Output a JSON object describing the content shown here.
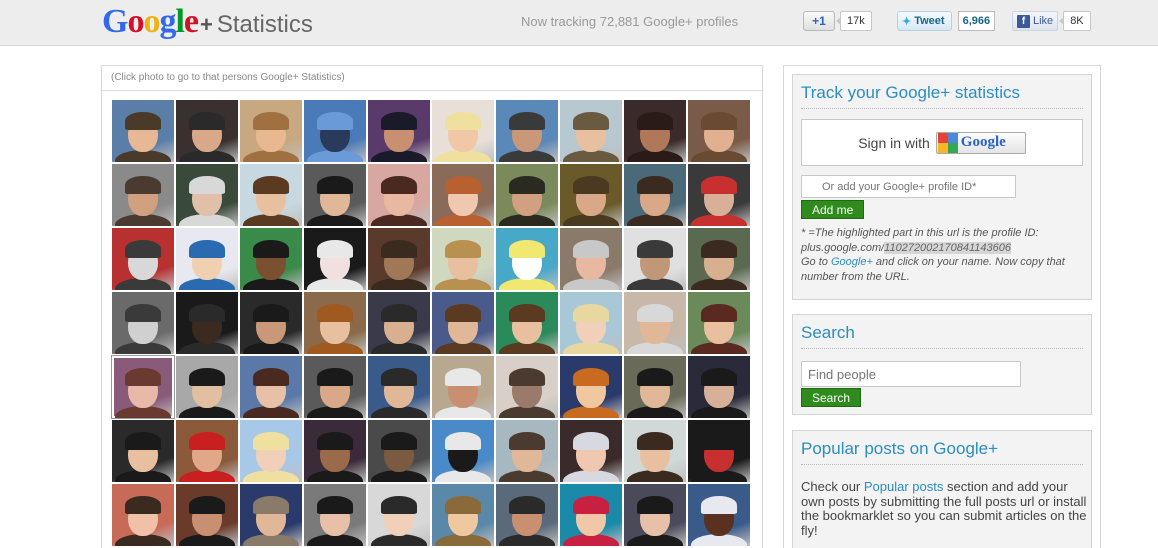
{
  "header": {
    "logo_parts": [
      "G",
      "o",
      "o",
      "g",
      "l",
      "e"
    ],
    "logo_plus": "+",
    "logo_suffix": "Statistics",
    "tracking_text": "Now tracking 72,881 Google+ profiles",
    "plus_one": {
      "label": "+1",
      "count": "17k"
    },
    "tweet": {
      "label": "Tweet",
      "count": "6,966"
    },
    "like": {
      "label": "Like",
      "count": "8K"
    }
  },
  "photos": {
    "caption": "(Click photo to go to that persons Google+ Statistics)",
    "tiles": [
      [
        "#5b7ea8",
        "#e8b896",
        "#4a3a2a"
      ],
      [
        "#3a3030",
        "#d8a888",
        "#2a2a2a"
      ],
      [
        "#c8a880",
        "#e8b890",
        "#a07040"
      ],
      [
        "#4a7ab8",
        "#2a3a5a",
        "#6a9ad8"
      ],
      [
        "#5a3a6a",
        "#c89070",
        "#1a1a2a"
      ],
      [
        "#e8e0d8",
        "#f0c8a8",
        "#f0e0a0"
      ],
      [
        "#5a88b8",
        "#c89878",
        "#3a3a3a"
      ],
      [
        "#b8c8d0",
        "#e8c0a0",
        "#6a5a40"
      ],
      [
        "#3a2a2a",
        "#b07858",
        "#2a1a18"
      ],
      [
        "#7a5a48",
        "#e0b090",
        "#6a4a30"
      ],
      [
        "#8a8a8a",
        "#d0a080",
        "#4a3a30"
      ],
      [
        "#3a4a3a",
        "#e0c0a8",
        "#d8d8d8"
      ],
      [
        "#c8d8e0",
        "#e8c0a0",
        "#5a3a20"
      ],
      [
        "#5a5a5a",
        "#e0b898",
        "#1a1a1a"
      ],
      [
        "#d8a8a0",
        "#e8b8a0",
        "#4a2a20"
      ],
      [
        "#8a6a58",
        "#f0c8b0",
        "#b86030"
      ],
      [
        "#7a8a5a",
        "#d0a080",
        "#2a2a20"
      ],
      [
        "#6a5a2a",
        "#d8a888",
        "#4a3a20"
      ],
      [
        "#4a6a7a",
        "#d8a888",
        "#3a2a20"
      ],
      [
        "#3a3a3a",
        "#d8b098",
        "#c83030"
      ],
      [
        "#b83030",
        "#d8d8d8",
        "#3a3a3a"
      ],
      [
        "#e8e8f0",
        "#f0d0b0",
        "#2a6ab0"
      ],
      [
        "#3a8a4a",
        "#7a5030",
        "#1a1a1a"
      ],
      [
        "#1a1a1a",
        "#f0e0e0",
        "#e8e8e8"
      ],
      [
        "#5a3a2a",
        "#a07858",
        "#3a2a20"
      ],
      [
        "#d0d8c0",
        "#e8c0a0",
        "#b89050"
      ],
      [
        "#48a8c8",
        "#ffffff",
        "#f0e870"
      ],
      [
        "#8a7a6a",
        "#e8b8a0",
        "#c8c8c8"
      ],
      [
        "#e0e0e0",
        "#c09878",
        "#3a3a3a"
      ],
      [
        "#5a6a50",
        "#d8b090",
        "#3a2a20"
      ],
      [
        "#6a6a6a",
        "#d0d0d0",
        "#3a3a3a"
      ],
      [
        "#1a1a1a",
        "#3a2a20",
        "#2a2a2a"
      ],
      [
        "#2a2a2a",
        "#c89878",
        "#1a1a1a"
      ],
      [
        "#8a6a4a",
        "#e8c0a0",
        "#a05a20"
      ],
      [
        "#3a3a4a",
        "#d8b090",
        "#2a2a2a"
      ],
      [
        "#4a5a8a",
        "#e0b898",
        "#5a3a20"
      ],
      [
        "#2a8a5a",
        "#e8c0a0",
        "#5a3a20"
      ],
      [
        "#a8c8d8",
        "#f0d0b8",
        "#e8d8a0"
      ],
      [
        "#c8b8a8",
        "#e0b898",
        "#d8d8d8"
      ],
      [
        "#6a8a5a",
        "#e8c0a0",
        "#5a2a20"
      ],
      [
        "#8a5a7a",
        "#e8b8a8",
        "#6a3a30"
      ],
      [
        "#a8a8a8",
        "#e0c0a0",
        "#1a1a1a"
      ],
      [
        "#5a78a8",
        "#e8c0a8",
        "#4a2a20"
      ],
      [
        "#5a5a5a",
        "#d8a888",
        "#1a1a1a"
      ],
      [
        "#3a5a8a",
        "#e0b898",
        "#2a2a2a"
      ],
      [
        "#b8a890",
        "#c89070",
        "#e8e8e8"
      ],
      [
        "#d8d0c8",
        "#9a7a6a",
        "#4a3a30"
      ],
      [
        "#2a3a6a",
        "#f0c8a0",
        "#c86a20"
      ],
      [
        "#6a6a58",
        "#e0b898",
        "#1a1a1a"
      ],
      [
        "#2a2a3a",
        "#d8b098",
        "#1a1a1a"
      ],
      [
        "#2a2a2a",
        "#e8c0a0",
        "#1a1a1a"
      ],
      [
        "#8a5a3a",
        "#e0a888",
        "#c82020"
      ],
      [
        "#a8c8e8",
        "#f0d0b8",
        "#f0e0a0"
      ],
      [
        "#3a2a3a",
        "#9a6a4a",
        "#1a1a1a"
      ],
      [
        "#4a4a4a",
        "#7a5a40",
        "#1a1a1a"
      ],
      [
        "#4a8ac8",
        "#1a1a1a",
        "#e8e8e8"
      ],
      [
        "#a8b8c0",
        "#e0b898",
        "#4a3a30"
      ],
      [
        "#3a2a2a",
        "#f0c8b0",
        "#d8d8e0"
      ],
      [
        "#d0d8d8",
        "#e8c0a0",
        "#3a2a20"
      ],
      [
        "#1a1a1a",
        "#c83030",
        "#1a1a1a"
      ],
      [
        "#c86a58",
        "#f0c0a8",
        "#3a2a20"
      ],
      [
        "#6a3a2a",
        "#c89070",
        "#1a1a1a"
      ],
      [
        "#2a3a6a",
        "#e0b898",
        "#8a7a6a"
      ],
      [
        "#7a7a7a",
        "#e8c0a8",
        "#1a1a1a"
      ],
      [
        "#d8d8d8",
        "#f0d0b8",
        "#2a2a2a"
      ],
      [
        "#5a88a8",
        "#f0c8a0",
        "#8a6a3a"
      ],
      [
        "#5a6a7a",
        "#c89070",
        "#2a2a2a"
      ],
      [
        "#1a8aa8",
        "#f0c8a8",
        "#c82040"
      ],
      [
        "#4a4a5a",
        "#e8c0a8",
        "#1a1a1a"
      ],
      [
        "#3a5a8a",
        "#5a3020",
        "#e8e8f0"
      ]
    ]
  },
  "track_box": {
    "title": "Track your Google+ statistics",
    "signin_text": "Sign in with",
    "google_word": "Google",
    "profile_id_placeholder": "Or add your Google+ profile ID*",
    "add_button": "Add me",
    "note_line1": "* =The highlighted part in this url is the profile ID:",
    "note_url_prefix": "plus.google.com/",
    "note_url_id": "110272002170841143606",
    "note_go_to": "Go to ",
    "note_link": "Google+",
    "note_rest": " and click on your name. Now copy that number from the URL."
  },
  "search_box": {
    "title": "Search",
    "placeholder": "Find people",
    "button": "Search"
  },
  "popular_box": {
    "title": "Popular posts on Google+",
    "text_before": "Check our ",
    "link": "Popular posts",
    "text_after": " section and add your own posts by submitting the full posts url or install the bookmarklet so you can submit articles on the fly!"
  },
  "colors": {
    "link_blue": "#2a8ec0",
    "button_green": "#2f8c1c",
    "logo": [
      "#3369e8",
      "#d50f25",
      "#eeb211",
      "#3369e8",
      "#009925",
      "#d50f25"
    ]
  }
}
